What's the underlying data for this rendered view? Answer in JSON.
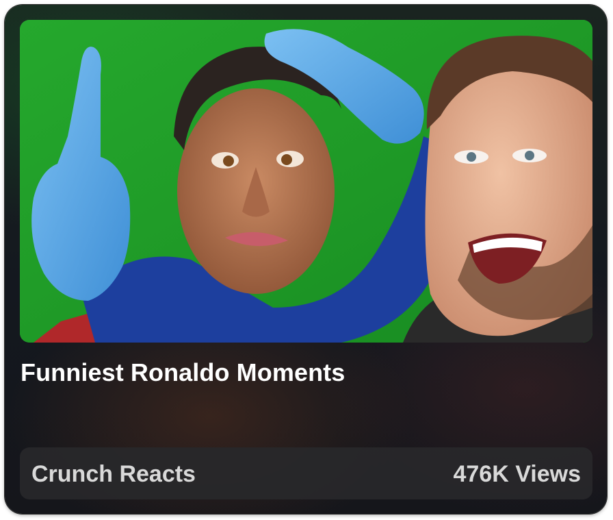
{
  "video": {
    "title": "Funniest Ronaldo Moments",
    "channel": "Crunch Reacts",
    "views": "476K Views"
  },
  "thumbnail": {
    "background_color": "#1f9a27",
    "glove_color": "#5aa9e8",
    "sleeve_color": "#1d3f9e"
  },
  "colors": {
    "card_background": "#15181d",
    "title_text": "#ffffff",
    "meta_text": "#d9d9d9",
    "meta_bar": "#28282a"
  }
}
